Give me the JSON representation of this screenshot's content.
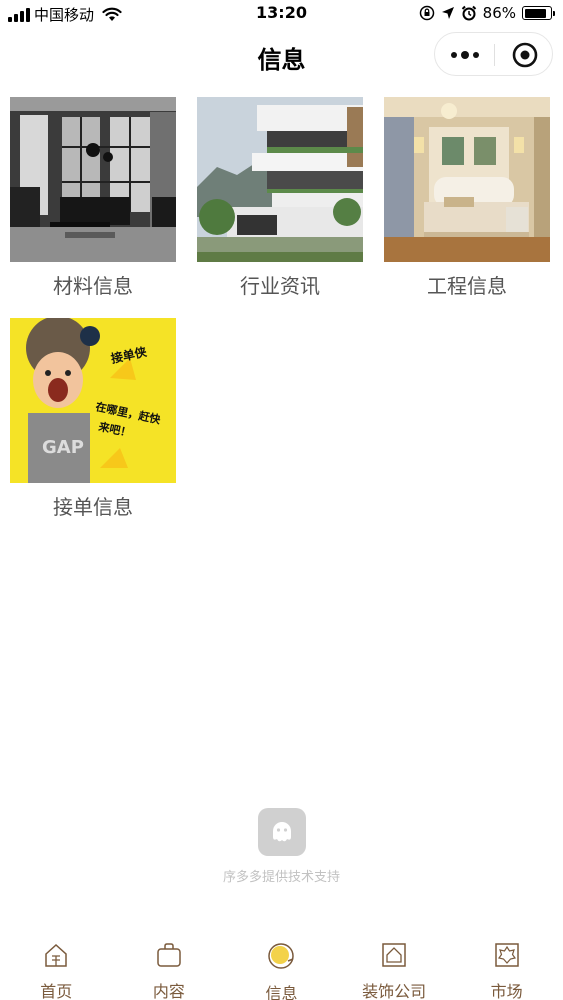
{
  "status_bar": {
    "carrier": "中国移动",
    "time": "13:20",
    "battery": "86%",
    "battery_level": 0.86
  },
  "nav": {
    "title": "信息"
  },
  "grid": [
    {
      "label": "材料信息",
      "image": "living-room-photo"
    },
    {
      "label": "行业资讯",
      "image": "villa-exterior-photo"
    },
    {
      "label": "工程信息",
      "image": "bedroom-photo"
    },
    {
      "label": "接单信息",
      "image": "jiedanxia-poster"
    }
  ],
  "poster_text": {
    "headline": "接单侠",
    "line1": "在哪里，赶快",
    "line2": "来吧！",
    "shirt": "GAP"
  },
  "footer": {
    "support_text": "序多多提供技术支持"
  },
  "tabs": [
    {
      "label": "首页",
      "icon": "home-icon"
    },
    {
      "label": "内容",
      "icon": "bag-icon"
    },
    {
      "label": "信息",
      "icon": "info-icon",
      "active": true
    },
    {
      "label": "装饰公司",
      "icon": "house-icon"
    },
    {
      "label": "市场",
      "icon": "market-icon"
    }
  ],
  "colors": {
    "tab_text": "#7a5a3c",
    "tab_active_icon": "#f3d24a",
    "poster_bg": "#f5e326"
  }
}
